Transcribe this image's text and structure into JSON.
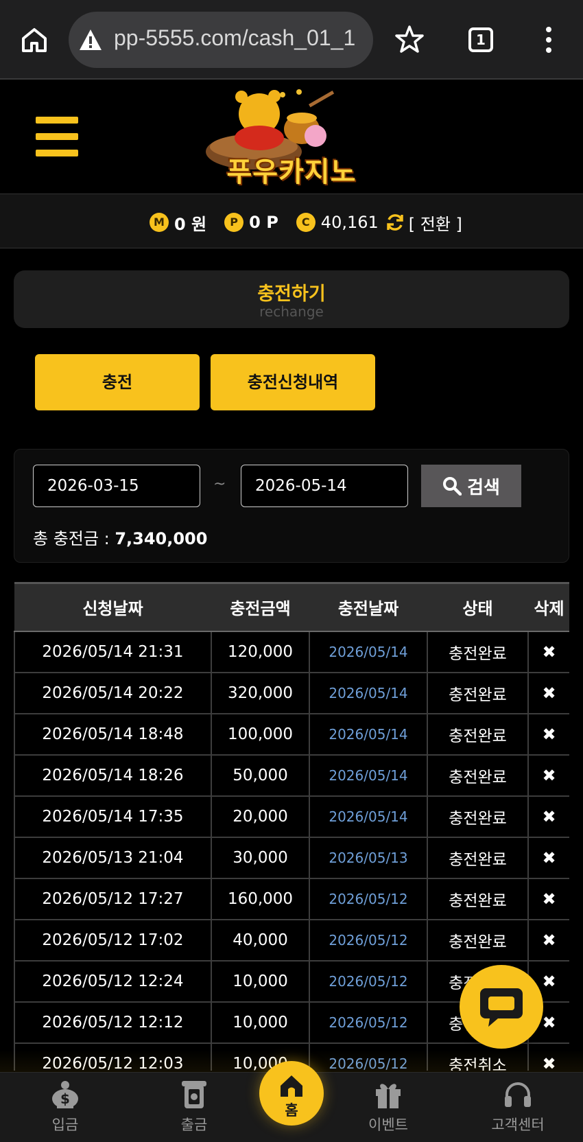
{
  "browser": {
    "url": "pp-5555.com/cash_01_1",
    "tab_count": "1"
  },
  "brand": {
    "logo_text": "푸우카지노",
    "accent": "#f8c21d"
  },
  "balance": {
    "money_badge": "M",
    "money": "0 원",
    "point_badge": "P",
    "point": "0 P",
    "casino_badge": "C",
    "casino": "40,161",
    "switch_label": "[ 전환 ]"
  },
  "title": {
    "ko": "충전하기",
    "en": "rechange"
  },
  "tabs": [
    {
      "label": "충전"
    },
    {
      "label": "충전신청내역"
    }
  ],
  "search": {
    "date_from": "2026-03-15",
    "date_to": "2026-05-14",
    "separator": "~",
    "button_label": "검색",
    "total_label": "총 충전금 :",
    "total_value": "7,340,000"
  },
  "table": {
    "headers": [
      "신청날짜",
      "충전금액",
      "충전날짜",
      "상태",
      "삭제"
    ],
    "rows": [
      {
        "req": "2026/05/14 21:31",
        "amount": "120,000",
        "date": "2026/05/14",
        "status": "충전완료",
        "del": "✖"
      },
      {
        "req": "2026/05/14 20:22",
        "amount": "320,000",
        "date": "2026/05/14",
        "status": "충전완료",
        "del": "✖"
      },
      {
        "req": "2026/05/14 18:48",
        "amount": "100,000",
        "date": "2026/05/14",
        "status": "충전완료",
        "del": "✖"
      },
      {
        "req": "2026/05/14 18:26",
        "amount": "50,000",
        "date": "2026/05/14",
        "status": "충전완료",
        "del": "✖"
      },
      {
        "req": "2026/05/14 17:35",
        "amount": "20,000",
        "date": "2026/05/14",
        "status": "충전완료",
        "del": "✖"
      },
      {
        "req": "2026/05/13 21:04",
        "amount": "30,000",
        "date": "2026/05/13",
        "status": "충전완료",
        "del": "✖"
      },
      {
        "req": "2026/05/12 17:27",
        "amount": "160,000",
        "date": "2026/05/12",
        "status": "충전완료",
        "del": "✖"
      },
      {
        "req": "2026/05/12 17:02",
        "amount": "40,000",
        "date": "2026/05/12",
        "status": "충전완료",
        "del": "✖"
      },
      {
        "req": "2026/05/12 12:24",
        "amount": "10,000",
        "date": "2026/05/12",
        "status": "충전완료",
        "del": "✖"
      },
      {
        "req": "2026/05/12 12:12",
        "amount": "10,000",
        "date": "2026/05/12",
        "status": "충전완료",
        "del": "✖"
      },
      {
        "req": "2026/05/12 12:03",
        "amount": "10,000",
        "date": "2026/05/12",
        "status": "충전취소",
        "del": "✖"
      }
    ]
  },
  "nav": {
    "deposit": "입금",
    "withdraw": "출금",
    "home": "홈",
    "event": "이벤트",
    "support": "고객센터"
  }
}
